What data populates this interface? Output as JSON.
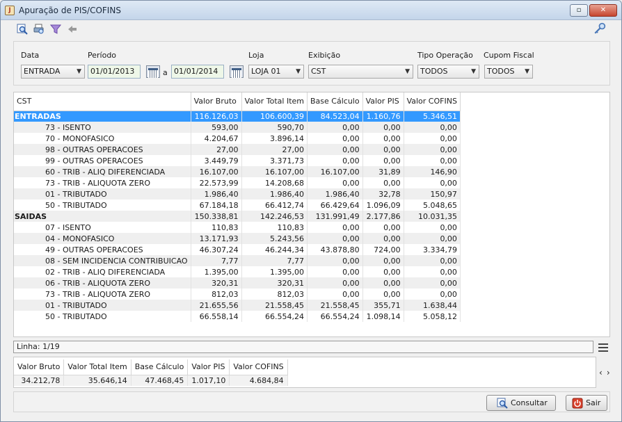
{
  "window": {
    "title": "Apuração de PIS/COFINS"
  },
  "filters": {
    "data_label": "Data",
    "data_value": "ENTRADA",
    "periodo_label": "Período",
    "periodo_inicio": "01/01/2013",
    "periodo_sep": "a",
    "periodo_fim": "01/01/2014",
    "loja_label": "Loja",
    "loja_value": "LOJA 01",
    "exibicao_label": "Exibição",
    "exibicao_value": "CST",
    "tipo_label": "Tipo Operação",
    "tipo_value": "TODOS",
    "cupom_label": "Cupom Fiscal",
    "cupom_value": "TODOS"
  },
  "grid": {
    "columns": [
      "CST",
      "Valor Bruto",
      "Valor Total Item",
      "Base Cálculo",
      "Valor PIS",
      "Valor COFINS"
    ],
    "rows": [
      {
        "type": "group",
        "selected": true,
        "cells": [
          "ENTRADAS",
          "116.126,03",
          "106.600,39",
          "84.523,04",
          "1.160,76",
          "5.346,51"
        ]
      },
      {
        "type": "child",
        "cells": [
          "73 - ISENTO",
          "593,00",
          "590,70",
          "0,00",
          "0,00",
          "0,00"
        ]
      },
      {
        "type": "child",
        "cells": [
          "70 - MONOFASICO",
          "4.204,67",
          "3.896,14",
          "0,00",
          "0,00",
          "0,00"
        ]
      },
      {
        "type": "child",
        "cells": [
          "98 - OUTRAS OPERACOES",
          "27,00",
          "27,00",
          "0,00",
          "0,00",
          "0,00"
        ]
      },
      {
        "type": "child",
        "cells": [
          "99 - OUTRAS OPERACOES",
          "3.449,79",
          "3.371,73",
          "0,00",
          "0,00",
          "0,00"
        ]
      },
      {
        "type": "child",
        "cells": [
          "60 - TRIB - ALIQ DIFERENCIADA",
          "16.107,00",
          "16.107,00",
          "16.107,00",
          "31,89",
          "146,90"
        ]
      },
      {
        "type": "child",
        "cells": [
          "73 - TRIB - ALIQUOTA ZERO",
          "22.573,99",
          "14.208,68",
          "0,00",
          "0,00",
          "0,00"
        ]
      },
      {
        "type": "child",
        "cells": [
          "01 - TRIBUTADO",
          "1.986,40",
          "1.986,40",
          "1.986,40",
          "32,78",
          "150,97"
        ]
      },
      {
        "type": "child",
        "cells": [
          "50 - TRIBUTADO",
          "67.184,18",
          "66.412,74",
          "66.429,64",
          "1.096,09",
          "5.048,65"
        ]
      },
      {
        "type": "group",
        "cells": [
          "SAIDAS",
          "150.338,81",
          "142.246,53",
          "131.991,49",
          "2.177,86",
          "10.031,35"
        ]
      },
      {
        "type": "child",
        "cells": [
          "07 - ISENTO",
          "110,83",
          "110,83",
          "0,00",
          "0,00",
          "0,00"
        ]
      },
      {
        "type": "child",
        "cells": [
          "04 - MONOFASICO",
          "13.171,93",
          "5.243,56",
          "0,00",
          "0,00",
          "0,00"
        ]
      },
      {
        "type": "child",
        "cells": [
          "49 - OUTRAS OPERACOES",
          "46.307,24",
          "46.244,34",
          "43.878,80",
          "724,00",
          "3.334,79"
        ]
      },
      {
        "type": "child",
        "cells": [
          "08 - SEM INCIDENCIA CONTRIBUICAO",
          "7,77",
          "7,77",
          "0,00",
          "0,00",
          "0,00"
        ]
      },
      {
        "type": "child",
        "cells": [
          "02 - TRIB - ALIQ DIFERENCIADA",
          "1.395,00",
          "1.395,00",
          "0,00",
          "0,00",
          "0,00"
        ]
      },
      {
        "type": "child",
        "cells": [
          "06 - TRIB - ALIQUOTA ZERO",
          "320,31",
          "320,31",
          "0,00",
          "0,00",
          "0,00"
        ]
      },
      {
        "type": "child",
        "cells": [
          "73 - TRIB - ALIQUOTA ZERO",
          "812,03",
          "812,03",
          "0,00",
          "0,00",
          "0,00"
        ]
      },
      {
        "type": "child",
        "cells": [
          "01 - TRIBUTADO",
          "21.655,56",
          "21.558,45",
          "21.558,45",
          "355,71",
          "1.638,44"
        ]
      },
      {
        "type": "child",
        "cells": [
          "50 - TRIBUTADO",
          "66.558,14",
          "66.554,24",
          "66.554,24",
          "1.098,14",
          "5.058,12"
        ]
      }
    ]
  },
  "status": {
    "linha": "Linha: 1/19"
  },
  "totals": {
    "columns": [
      "Valor Bruto",
      "Valor Total Item",
      "Base Cálculo",
      "Valor PIS",
      "Valor COFINS"
    ],
    "values": [
      "34.212,78",
      "35.646,14",
      "47.468,45",
      "1.017,10",
      "4.684,84"
    ]
  },
  "buttons": {
    "consultar": "Consultar",
    "sair": "Sair"
  },
  "icons": {
    "toolbar": [
      "search-icon",
      "print-preview-icon",
      "filter-icon",
      "back-arrow-icon"
    ],
    "toolbar_right": "key-icon"
  },
  "colors": {
    "selection": "#3399ff",
    "close": "#c6452e"
  }
}
